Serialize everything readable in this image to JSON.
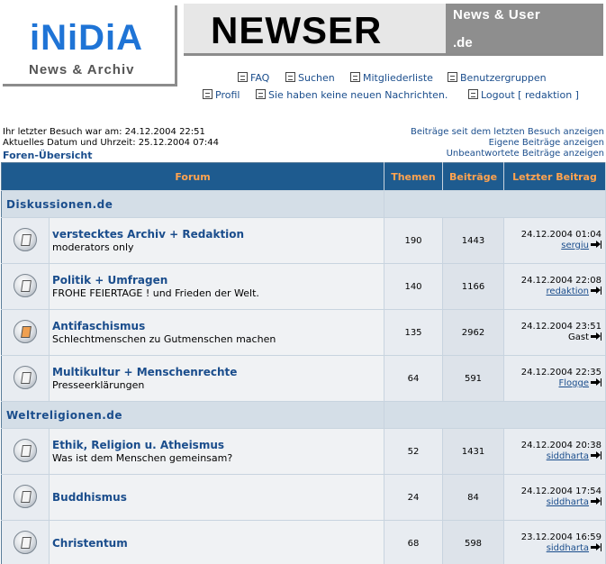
{
  "header": {
    "left_logo": {
      "brand": "iNiDiA",
      "subtitle": "News & Archiv"
    },
    "right_logo": {
      "title": "NEWSER",
      "tag_line1": "News & User",
      "tag_line2": ".de"
    }
  },
  "nav": {
    "row1": [
      "FAQ",
      "Suchen",
      "Mitgliederliste",
      "Benutzergruppen"
    ],
    "row2": [
      "Profil",
      "Sie haben keine neuen Nachrichten.",
      "Logout [ redaktion ]"
    ]
  },
  "info": {
    "last_visit": "Ihr letzter Besuch war am: 24.12.2004 22:51",
    "current_time": "Aktuelles Datum und Uhrzeit: 25.12.2004 07:44",
    "forum_index": "Foren-Übersicht",
    "link_since_last": "Beiträge seit dem letzten Besuch anzeigen",
    "link_own": "Eigene Beiträge anzeigen",
    "link_unanswered": "Unbeantwortete Beiträge anzeigen"
  },
  "table": {
    "headers": [
      "Forum",
      "Themen",
      "Beiträge",
      "Letzter Beitrag"
    ],
    "categories": [
      {
        "title": "Diskussionen.de",
        "forums": [
          {
            "name": "verstecktes Archiv + Redaktion",
            "desc": "moderators only",
            "topics": "190",
            "posts": "1443",
            "last_date": "24.12.2004 01:04",
            "last_user": "sergiu",
            "user_link": true,
            "icon_state": "normal"
          },
          {
            "name": "Politik + Umfragen",
            "desc": "FROHE FEIERTAGE ! und Frieden der Welt.",
            "topics": "140",
            "posts": "1166",
            "last_date": "24.12.2004 22:08",
            "last_user": "redaktion",
            "user_link": true,
            "icon_state": "normal"
          },
          {
            "name": "Antifaschismus",
            "desc": "Schlechtmenschen zu Gutmenschen machen",
            "topics": "135",
            "posts": "2962",
            "last_date": "24.12.2004 23:51",
            "last_user": "Gast",
            "user_link": false,
            "icon_state": "new"
          },
          {
            "name": "Multikultur + Menschenrechte",
            "desc": "Presseerklärungen",
            "topics": "64",
            "posts": "591",
            "last_date": "24.12.2004 22:35",
            "last_user": "Flogge",
            "user_link": true,
            "icon_state": "normal"
          }
        ]
      },
      {
        "title": "Weltreligionen.de",
        "forums": [
          {
            "name": "Ethik, Religion u. Atheismus",
            "desc": "Was ist dem Menschen gemeinsam?",
            "topics": "52",
            "posts": "1431",
            "last_date": "24.12.2004 20:38",
            "last_user": "siddharta",
            "user_link": true,
            "icon_state": "normal"
          },
          {
            "name": "Buddhismus",
            "desc": "",
            "topics": "24",
            "posts": "84",
            "last_date": "24.12.2004 17:54",
            "last_user": "siddharta",
            "user_link": true,
            "icon_state": "normal"
          },
          {
            "name": "Christentum",
            "desc": "",
            "topics": "68",
            "posts": "598",
            "last_date": "23.12.2004 16:59",
            "last_user": "siddharta",
            "user_link": true,
            "icon_state": "normal"
          }
        ]
      }
    ]
  }
}
